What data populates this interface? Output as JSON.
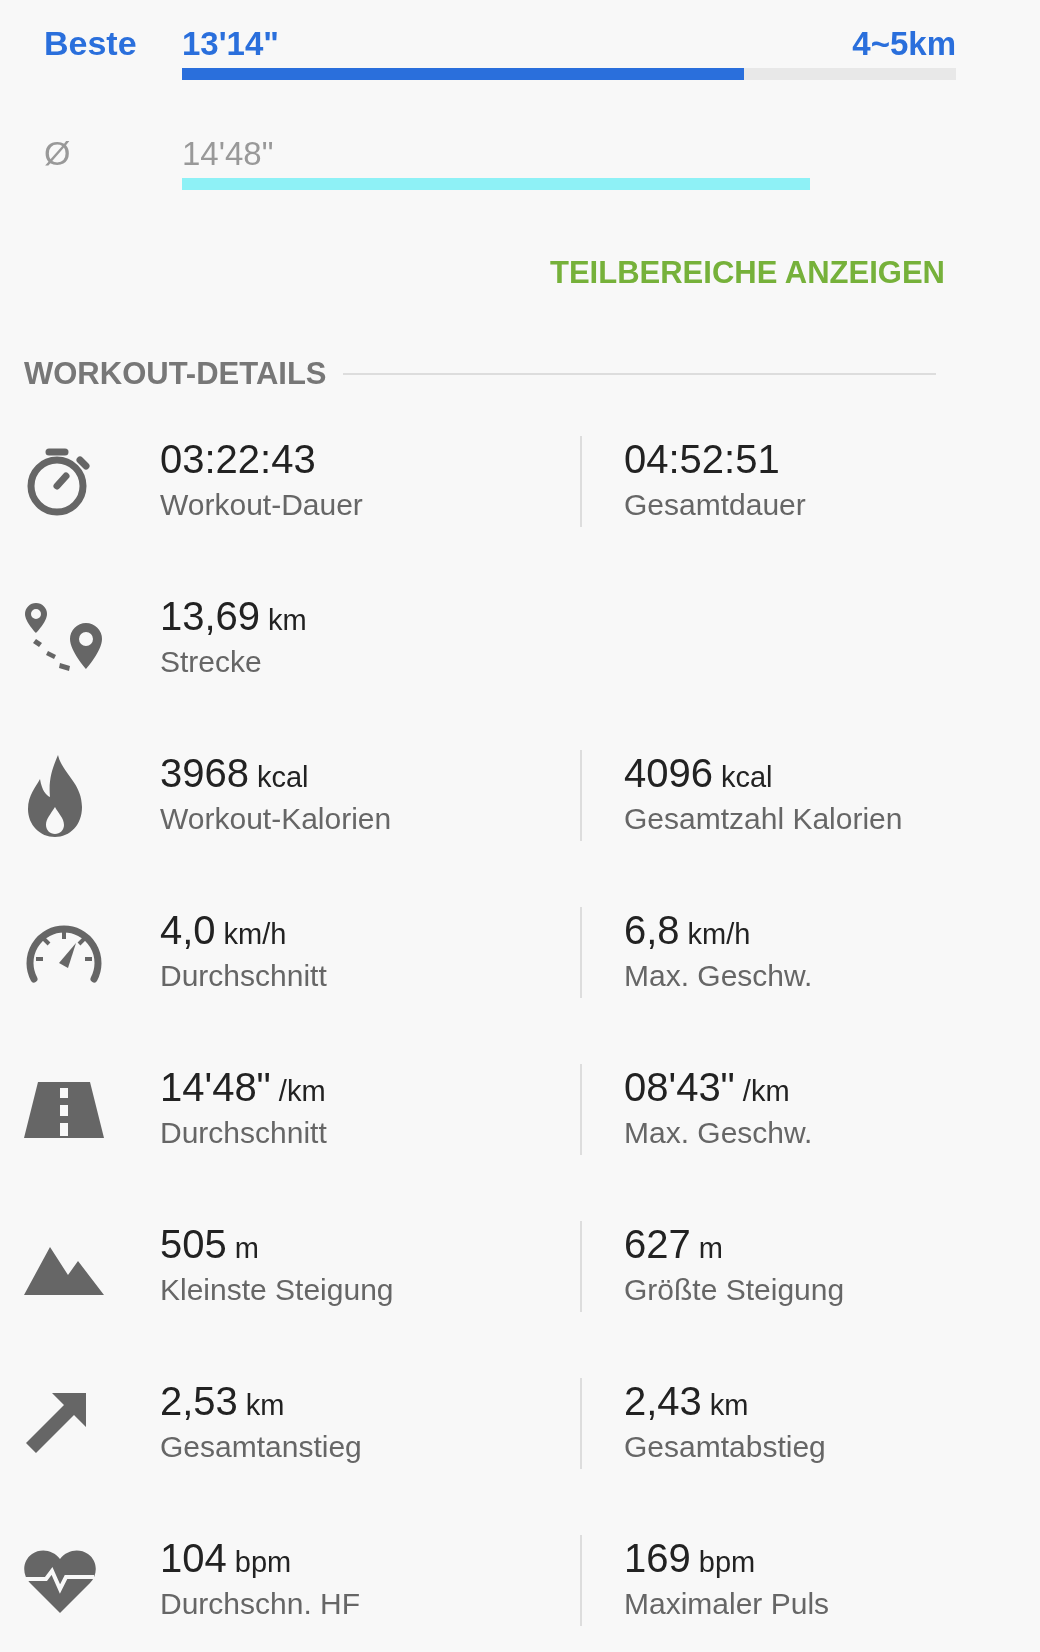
{
  "comparison": [
    {
      "kind": "best",
      "label": "Beste",
      "value": "13'14\"",
      "range": "4~5km",
      "level": 0.726
    },
    {
      "kind": "average",
      "label": "Ø",
      "value": "14'48\""
    }
  ],
  "segments_button": "TEILBEREICHE ANZEIGEN",
  "section_title": "WORKOUT-DETAILS",
  "details": [
    {
      "kind": "duration",
      "left": {
        "value": "03:22:43",
        "label": "Workout-Dauer"
      },
      "right": {
        "value": "04:52:51",
        "label": "Gesamtdauer"
      }
    },
    {
      "kind": "distance",
      "left": {
        "value": "13,69",
        "unit": "km",
        "label": "Strecke"
      }
    },
    {
      "kind": "calories",
      "left": {
        "value": "3968",
        "unit": "kcal",
        "label": "Workout-Kalorien"
      },
      "right": {
        "value": "4096",
        "unit": "kcal",
        "label": "Gesamtzahl Kalorien"
      }
    },
    {
      "kind": "speed",
      "left": {
        "value": "4,0",
        "unit": "km/h",
        "label": "Durchschnitt"
      },
      "right": {
        "value": "6,8",
        "unit": "km/h",
        "label": "Max. Geschw."
      }
    },
    {
      "kind": "pace",
      "left": {
        "value": "14'48\"",
        "unit": "/km",
        "label": "Durchschnitt"
      },
      "right": {
        "value": "08'43\"",
        "unit": "/km",
        "label": "Max. Geschw."
      }
    },
    {
      "kind": "altitude",
      "left": {
        "value": "505",
        "unit": "m",
        "label": "Kleinste Steigung"
      },
      "right": {
        "value": "627",
        "unit": "m",
        "label": "Größte Steigung"
      }
    },
    {
      "kind": "elevation",
      "left": {
        "value": "2,53",
        "unit": "km",
        "label": "Gesamtanstieg"
      },
      "right": {
        "value": "2,43",
        "unit": "km",
        "label": "Gesamtabstieg"
      }
    },
    {
      "kind": "heart_rate",
      "left": {
        "value": "104",
        "unit": "bpm",
        "label": "Durchschn. HF"
      },
      "right": {
        "value": "169",
        "unit": "bpm",
        "label": "Maximaler Puls"
      }
    }
  ]
}
